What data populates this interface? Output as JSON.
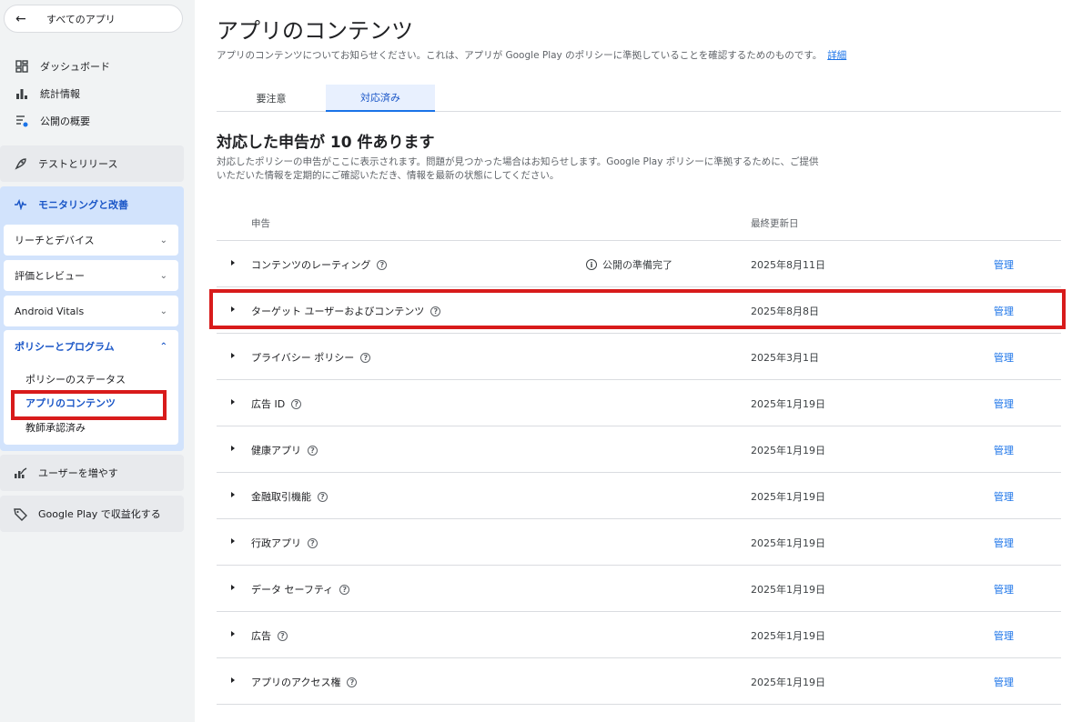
{
  "sidebar": {
    "back_label": "すべてのアプリ",
    "top_items": [
      {
        "label": "ダッシュボード",
        "icon": "dashboard-icon"
      },
      {
        "label": "統計情報",
        "icon": "bar-chart-icon"
      },
      {
        "label": "公開の概要",
        "icon": "publishing-overview-icon"
      }
    ],
    "test_release": "テストとリリース",
    "monitoring": "モニタリングと改善",
    "sub_items": [
      "リーチとデバイス",
      "評価とレビュー",
      "Android Vitals"
    ],
    "policy": {
      "label": "ポリシーとプログラム",
      "children": [
        "ポリシーのステータス",
        "アプリのコンテンツ",
        "教師承認済み"
      ]
    },
    "grow": "ユーザーを増やす",
    "monetize": "Google Play で収益化する"
  },
  "main": {
    "title": "アプリのコンテンツ",
    "subtitle": "アプリのコンテンツについてお知らせください。これは、アプリが Google Play のポリシーに準拠していることを確認するためのものです。",
    "subtitle_link": "詳細",
    "tabs": [
      "要注意",
      "対応済み"
    ],
    "heading": "対応した申告が 10 件あります",
    "description_line1": "対応したポリシーの申告がここに表示されます。問題が見つかった場合はお知らせします。Google Play ポリシーに準拠するために、ご提供",
    "description_line2": "いただいた情報を定期的にご確認いただき、情報を最新の状態にしてください。",
    "columns": {
      "declaration": "申告",
      "last_updated": "最終更新日"
    },
    "rows": [
      {
        "name": "コンテンツのレーティング",
        "status": "公開の準備完了",
        "date": "2025年8月11日",
        "action": "管理"
      },
      {
        "name": "ターゲット ユーザーおよびコンテンツ",
        "status": "",
        "date": "2025年8月8日",
        "action": "管理"
      },
      {
        "name": "プライバシー ポリシー",
        "status": "",
        "date": "2025年3月1日",
        "action": "管理"
      },
      {
        "name": "広告 ID",
        "status": "",
        "date": "2025年1月19日",
        "action": "管理"
      },
      {
        "name": "健康アプリ",
        "status": "",
        "date": "2025年1月19日",
        "action": "管理"
      },
      {
        "name": "金融取引機能",
        "status": "",
        "date": "2025年1月19日",
        "action": "管理"
      },
      {
        "name": "行政アプリ",
        "status": "",
        "date": "2025年1月19日",
        "action": "管理"
      },
      {
        "name": "データ セーフティ",
        "status": "",
        "date": "2025年1月19日",
        "action": "管理"
      },
      {
        "name": "広告",
        "status": "",
        "date": "2025年1月19日",
        "action": "管理"
      },
      {
        "name": "アプリのアクセス権",
        "status": "",
        "date": "2025年1月19日",
        "action": "管理"
      }
    ]
  },
  "colors": {
    "accent": "#1a73e8",
    "highlight": "#d81b1b",
    "active_bg": "#d2e3fc"
  }
}
